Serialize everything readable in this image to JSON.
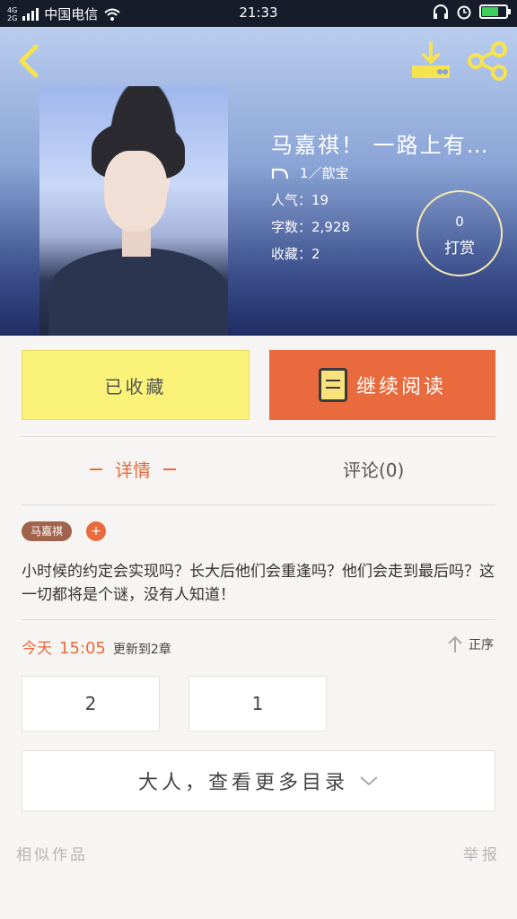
{
  "status_bar": {
    "network": "4G\n2G",
    "carrier": "中国电信",
    "time": "21:33",
    "battery_level": 0.7
  },
  "header": {
    "title": "马嘉祺！ 一路上有…",
    "author": "1／歆宝",
    "popularity": "人气：19",
    "word_count": "字数：2,928",
    "favorites": "收藏：2",
    "tip_count": "0",
    "tip_label": "打赏"
  },
  "actions": {
    "favorite_label": "已收藏",
    "read_label": "继续阅读"
  },
  "tabs": {
    "detail": "详情",
    "comments": "评论(0)"
  },
  "tags": [
    "马嘉祺"
  ],
  "tag_add_symbol": "+",
  "description": "小时候的约定会实现吗？长大后他们会重逢吗？他们会走到最后吗？这一切都将是个谜，没有人知道！",
  "update": {
    "day": "今天",
    "time": "15:05",
    "text": "更新到2章",
    "order_label": "正序"
  },
  "chapters": [
    "2",
    "1"
  ],
  "more_catalog": "大人，查看更多目录",
  "footer": {
    "similar": "相似作品",
    "report": "举报"
  },
  "colors": {
    "accent": "#e96a3c",
    "favorite_bg": "#fbf27a",
    "tag": "#a0634c"
  }
}
